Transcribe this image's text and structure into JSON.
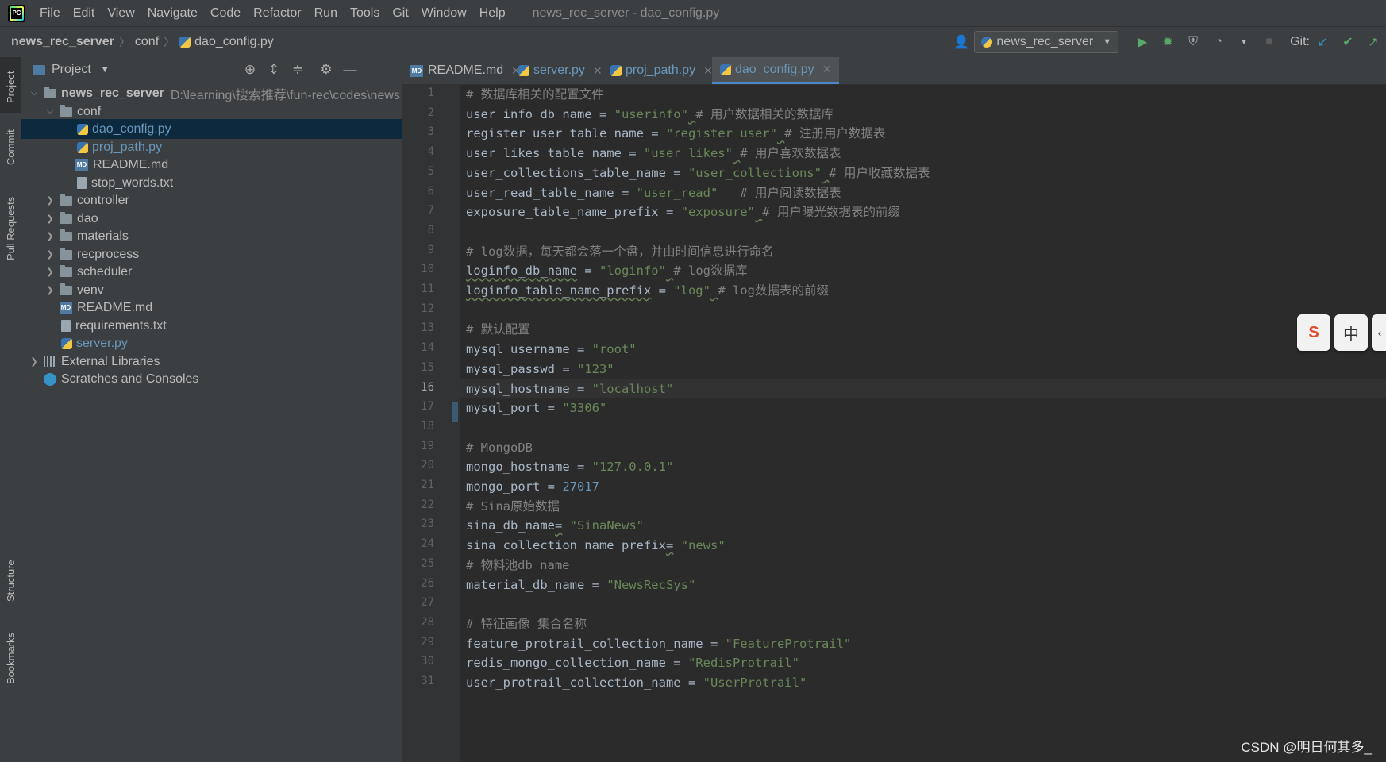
{
  "menubar": {
    "items": [
      "File",
      "Edit",
      "View",
      "Navigate",
      "Code",
      "Refactor",
      "Run",
      "Tools",
      "Git",
      "Window",
      "Help"
    ],
    "window_title": "news_rec_server - dao_config.py"
  },
  "navbar": {
    "breadcrumbs": [
      "news_rec_server",
      "conf",
      "dao_config.py"
    ],
    "run_config": "news_rec_server",
    "git_label": "Git:"
  },
  "side_tabs": [
    "Project",
    "Commit",
    "Pull Requests",
    "Structure",
    "Bookmarks"
  ],
  "project_panel": {
    "title": "Project",
    "root_name": "news_rec_server",
    "root_path": "D:\\learning\\搜索推荐\\fun-rec\\codes\\news",
    "tree": [
      "conf",
      "dao_config.py",
      "proj_path.py",
      "README.md",
      "stop_words.txt",
      "controller",
      "dao",
      "materials",
      "recprocess",
      "scheduler",
      "venv",
      "README.md",
      "requirements.txt",
      "server.py",
      "External Libraries",
      "Scratches and Consoles"
    ]
  },
  "tabs": [
    "README.md",
    "server.py",
    "proj_path.py",
    "dao_config.py"
  ],
  "editor": {
    "current_line": 16,
    "lines": [
      {
        "n": "1",
        "parts": [
          [
            "cm",
            "# 数据库相关的配置文件"
          ]
        ]
      },
      {
        "n": "2",
        "parts": [
          [
            "tx",
            "user_info_db_name = "
          ],
          [
            "st",
            "\"userinfo\""
          ],
          [
            "ul",
            " "
          ],
          [
            "cm",
            "# 用户数据相关的数据库"
          ]
        ]
      },
      {
        "n": "3",
        "parts": [
          [
            "tx",
            "register_user_table_name = "
          ],
          [
            "st",
            "\"register_user\""
          ],
          [
            "ul",
            " "
          ],
          [
            "cm",
            "# 注册用户数据表"
          ]
        ]
      },
      {
        "n": "4",
        "parts": [
          [
            "tx",
            "user_likes_table_name = "
          ],
          [
            "st",
            "\"user_likes\""
          ],
          [
            "ul",
            " "
          ],
          [
            "cm",
            "# 用户喜欢数据表"
          ]
        ]
      },
      {
        "n": "5",
        "parts": [
          [
            "tx",
            "user_collections_table_name = "
          ],
          [
            "st",
            "\"user_collections\""
          ],
          [
            "ul",
            " "
          ],
          [
            "cm",
            "# 用户收藏数据表"
          ]
        ]
      },
      {
        "n": "6",
        "parts": [
          [
            "tx",
            "user_read_table_name = "
          ],
          [
            "st",
            "\"user_read\""
          ],
          [
            "tx",
            "   "
          ],
          [
            "cm",
            "# 用户阅读数据表"
          ]
        ]
      },
      {
        "n": "7",
        "parts": [
          [
            "tx",
            "exposure_table_name_prefix = "
          ],
          [
            "st",
            "\"exposure\""
          ],
          [
            "ul",
            " "
          ],
          [
            "cm",
            "# 用户曝光数据表的前缀"
          ]
        ]
      },
      {
        "n": "8",
        "parts": []
      },
      {
        "n": "9",
        "parts": [
          [
            "cm",
            "# log数据，每天都会落一个盘，并由时间信息进行命名"
          ]
        ]
      },
      {
        "n": "10",
        "parts": [
          [
            "ul",
            "loginfo_db_name"
          ],
          [
            "tx",
            " = "
          ],
          [
            "st",
            "\"loginfo\""
          ],
          [
            "ul",
            " "
          ],
          [
            "cm",
            "# log数据库"
          ]
        ]
      },
      {
        "n": "11",
        "parts": [
          [
            "ul",
            "loginfo_table_name_prefix"
          ],
          [
            "tx",
            " = "
          ],
          [
            "st",
            "\"log\""
          ],
          [
            "ul",
            " "
          ],
          [
            "cm",
            "# log数据表的前缀"
          ]
        ]
      },
      {
        "n": "12",
        "parts": []
      },
      {
        "n": "13",
        "parts": [
          [
            "cm",
            "# 默认配置"
          ]
        ]
      },
      {
        "n": "14",
        "parts": [
          [
            "tx",
            "mysql_username = "
          ],
          [
            "st",
            "\"root\""
          ]
        ]
      },
      {
        "n": "15",
        "parts": [
          [
            "tx",
            "mysql_passwd = "
          ],
          [
            "st",
            "\"123\""
          ]
        ]
      },
      {
        "n": "16",
        "parts": [
          [
            "tx",
            "mysql_hostname = "
          ],
          [
            "st",
            "\"localhost\""
          ]
        ]
      },
      {
        "n": "17",
        "parts": [
          [
            "tx",
            "mysql_port = "
          ],
          [
            "st",
            "\"3306\""
          ]
        ]
      },
      {
        "n": "18",
        "parts": []
      },
      {
        "n": "19",
        "parts": [
          [
            "cm",
            "# MongoDB"
          ]
        ]
      },
      {
        "n": "20",
        "parts": [
          [
            "tx",
            "mongo_hostname = "
          ],
          [
            "st",
            "\"127.0.0.1\""
          ]
        ]
      },
      {
        "n": "21",
        "parts": [
          [
            "tx",
            "mongo_port = "
          ],
          [
            "nm",
            "27017"
          ]
        ]
      },
      {
        "n": "22",
        "parts": [
          [
            "cm",
            "# Sina原始数据"
          ]
        ]
      },
      {
        "n": "23",
        "parts": [
          [
            "tx",
            "sina_db_name"
          ],
          [
            "ul",
            "="
          ],
          [
            "tx",
            " "
          ],
          [
            "st",
            "\"SinaNews\""
          ]
        ]
      },
      {
        "n": "24",
        "parts": [
          [
            "tx",
            "sina_collection_name_prefix"
          ],
          [
            "ul",
            "="
          ],
          [
            "tx",
            " "
          ],
          [
            "st",
            "\"news\""
          ]
        ]
      },
      {
        "n": "25",
        "parts": [
          [
            "cm",
            "# 物料池db name"
          ]
        ]
      },
      {
        "n": "26",
        "parts": [
          [
            "tx",
            "material_db_name = "
          ],
          [
            "st",
            "\"NewsRecSys\""
          ]
        ]
      },
      {
        "n": "27",
        "parts": []
      },
      {
        "n": "28",
        "parts": [
          [
            "cm",
            "# 特征画像 集合名称"
          ]
        ]
      },
      {
        "n": "29",
        "parts": [
          [
            "tx",
            "feature_protrail_collection_name = "
          ],
          [
            "st",
            "\"FeatureProtrail\""
          ]
        ]
      },
      {
        "n": "30",
        "parts": [
          [
            "tx",
            "redis_mongo_collection_name = "
          ],
          [
            "st",
            "\"RedisProtrail\""
          ]
        ]
      },
      {
        "n": "31",
        "parts": [
          [
            "tx",
            "user_protrail_collection_name = "
          ],
          [
            "st",
            "\"UserProtrail\""
          ]
        ]
      }
    ]
  },
  "ime": {
    "sogou": "S",
    "mode": "中"
  },
  "watermark": "CSDN @明日何其多_"
}
